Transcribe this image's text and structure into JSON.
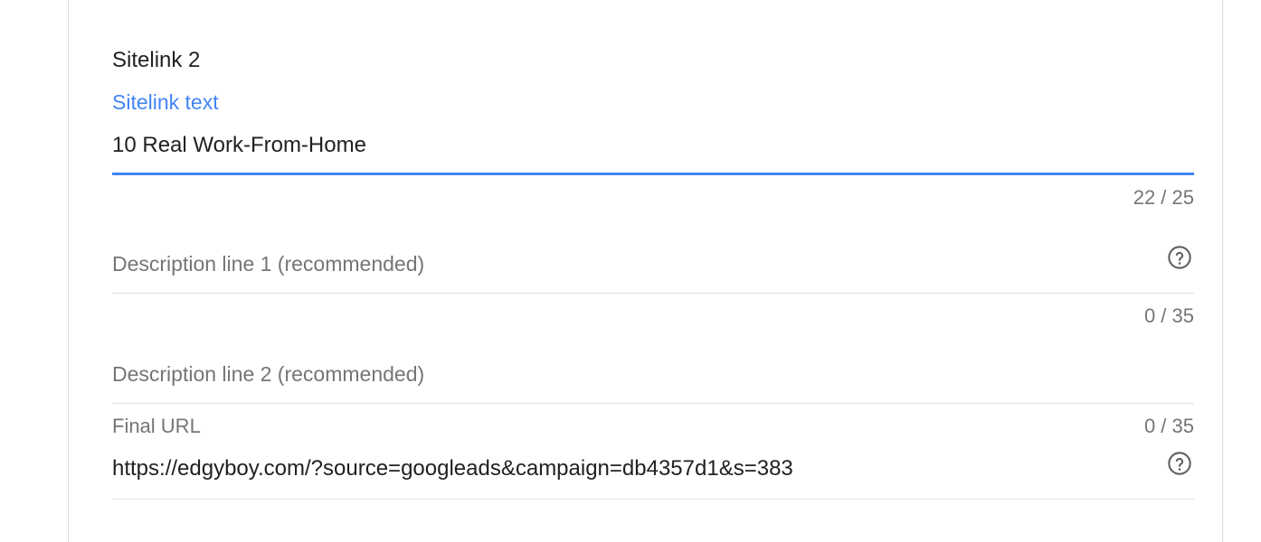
{
  "sitelink": {
    "title": "Sitelink 2",
    "text_field": {
      "label": "Sitelink text",
      "value": "10 Real Work-From-Home",
      "counter": "22 / 25"
    },
    "description1": {
      "placeholder": "Description line 1 (recommended)",
      "counter": "0 / 35",
      "help_icon": "help-circle-icon"
    },
    "description2": {
      "placeholder": "Description line 2 (recommended)",
      "counter": "0 / 35"
    },
    "final_url": {
      "label": "Final URL",
      "value": "https://edgyboy.com/?source=googleads&campaign=db4357d1&s=383",
      "help_icon": "help-circle-icon"
    }
  },
  "colors": {
    "accent": "#4285f4",
    "text_primary": "#212121",
    "text_secondary": "#757575",
    "divider": "#e0e0e0"
  }
}
